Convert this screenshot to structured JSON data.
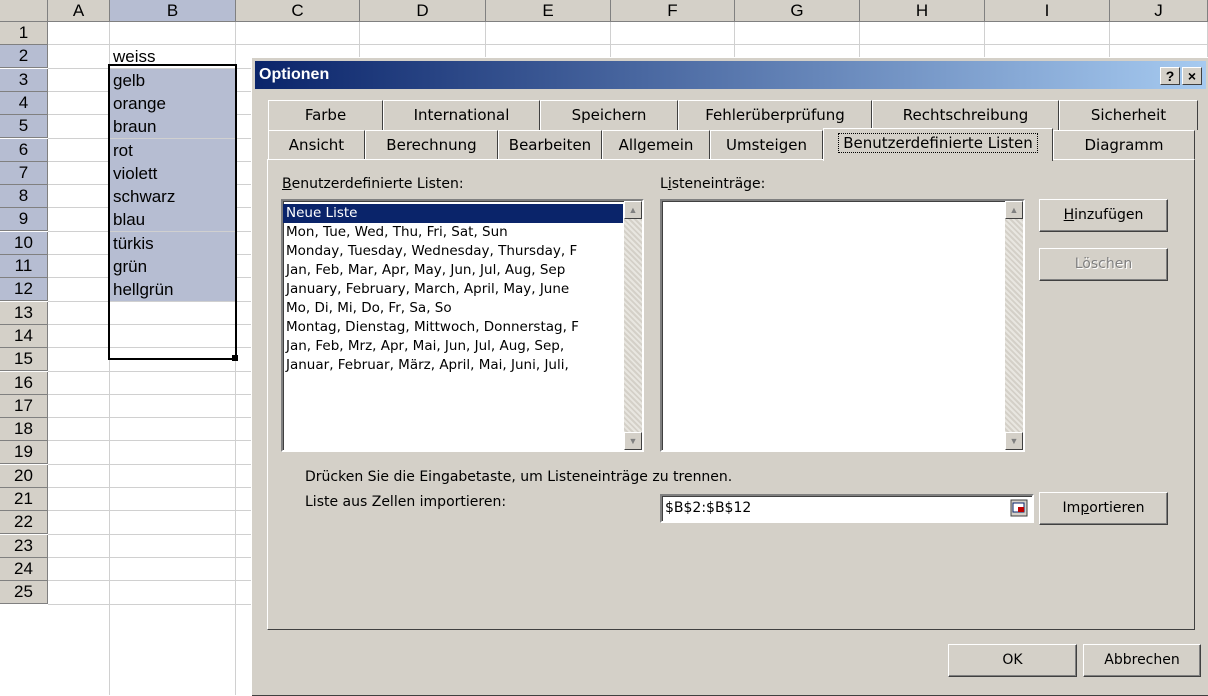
{
  "spreadsheet": {
    "columns": [
      "A",
      "B",
      "C",
      "D",
      "E",
      "F",
      "G",
      "H",
      "I",
      "J"
    ],
    "rows": [
      "1",
      "2",
      "3",
      "4",
      "5",
      "6",
      "7",
      "8",
      "9",
      "10",
      "11",
      "12",
      "13",
      "14",
      "15",
      "16",
      "17",
      "18",
      "19",
      "20",
      "21",
      "22",
      "23",
      "24",
      "25"
    ],
    "cells_B": [
      "weiss",
      "gelb",
      "orange",
      "braun",
      "rot",
      "violett",
      "schwarz",
      "blau",
      "türkis",
      "grün",
      "hellgrün"
    ]
  },
  "dialog": {
    "title": "Optionen",
    "help_button": "?",
    "close_button": "×",
    "tabs_row1": [
      "Farbe",
      "International",
      "Speichern",
      "Fehlerüberprüfung",
      "Rechtschreibung",
      "Sicherheit"
    ],
    "tabs_row2": [
      "Ansicht",
      "Berechnung",
      "Bearbeiten",
      "Allgemein",
      "Umsteigen",
      "Benutzerdefinierte Listen",
      "Diagramm"
    ],
    "active_tab": "Benutzerdefinierte Listen",
    "custom_lists_label": "Benutzerdefinierte Listen:",
    "custom_lists_access": "B",
    "custom_lists_label_rest": "enutzerdefinierte Listen:",
    "custom_lists": [
      "Neue Liste",
      "Mon, Tue, Wed, Thu, Fri, Sat, Sun",
      "Monday, Tuesday, Wednesday, Thursday, F",
      "Jan, Feb, Mar, Apr, May, Jun, Jul, Aug, Sep",
      "January, February, March, April, May, June",
      "Mo, Di, Mi, Do, Fr, Sa, So",
      "Montag, Dienstag, Mittwoch, Donnerstag, F",
      "Jan, Feb, Mrz, Apr, Mai, Jun, Jul, Aug, Sep,",
      "Januar, Februar, März, April, Mai, Juni, Juli,"
    ],
    "entries_label_pre": "L",
    "entries_label_access": "i",
    "entries_label_rest": "steneinträge:",
    "add_button_access": "H",
    "add_button_rest": "inzufügen",
    "delete_button": "Löschen",
    "hint_text": "Drücken Sie die Eingabetaste, um Listeneinträge zu trennen.",
    "import_label": "Liste aus Zellen importieren:",
    "import_range": "$B$2:$B$12",
    "import_button_pre": "Im",
    "import_button_access": "p",
    "import_button_rest": "ortieren",
    "ok_button": "OK",
    "cancel_button": "Abbrechen"
  },
  "colors": {
    "selection_fill": "#b6bdd2",
    "titlebar_start": "#0a246a",
    "titlebar_end": "#a6caf0",
    "dialog_face": "#d4d0c8"
  }
}
